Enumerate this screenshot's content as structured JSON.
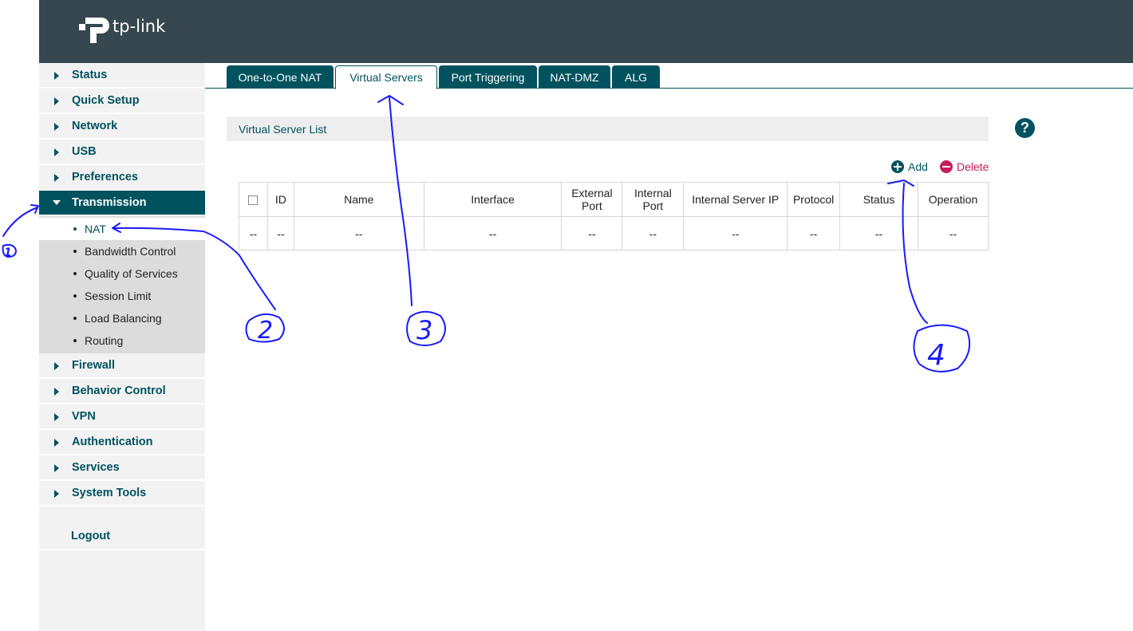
{
  "brand": {
    "name": "tp-link"
  },
  "sidebar": {
    "items": [
      {
        "label": "Status"
      },
      {
        "label": "Quick Setup"
      },
      {
        "label": "Network"
      },
      {
        "label": "USB"
      },
      {
        "label": "Preferences"
      },
      {
        "label": "Transmission"
      }
    ],
    "submenu": [
      {
        "label": "NAT"
      },
      {
        "label": "Bandwidth Control"
      },
      {
        "label": "Quality of Services"
      },
      {
        "label": "Session Limit"
      },
      {
        "label": "Load Balancing"
      },
      {
        "label": "Routing"
      }
    ],
    "items_after": [
      {
        "label": "Firewall"
      },
      {
        "label": "Behavior Control"
      },
      {
        "label": "VPN"
      },
      {
        "label": "Authentication"
      },
      {
        "label": "Services"
      },
      {
        "label": "System Tools"
      }
    ],
    "logout": "Logout",
    "active_item": "Transmission",
    "selected_subitem": "NAT"
  },
  "tabs": [
    {
      "label": "One-to-One NAT"
    },
    {
      "label": "Virtual Servers"
    },
    {
      "label": "Port Triggering"
    },
    {
      "label": "NAT-DMZ"
    },
    {
      "label": "ALG"
    }
  ],
  "active_tab": "Virtual Servers",
  "panel": {
    "title": "Virtual Server List",
    "help": "?",
    "add_label": "Add",
    "delete_label": "Delete"
  },
  "table": {
    "headers": [
      "ID",
      "Name",
      "Interface",
      "External Port",
      "Internal Port",
      "Internal Server IP",
      "Protocol",
      "Status",
      "Operation"
    ],
    "header_lines": {
      "external_1": "External",
      "external_2": "Port",
      "internal_1": "Internal",
      "internal_2": "Port"
    },
    "rows": [
      [
        "--",
        "--",
        "--",
        "--",
        "--",
        "--",
        "--",
        "--",
        "--",
        "--"
      ]
    ]
  },
  "annotations": [
    "1",
    "2",
    "3",
    "4"
  ],
  "colors": {
    "header_bg": "#37474f",
    "accent": "#00525e",
    "delete": "#c41e5c",
    "sidebar_bg": "#f2f2f2",
    "submenu_bg": "#dcdcdc",
    "ink": "#1a1aff"
  }
}
